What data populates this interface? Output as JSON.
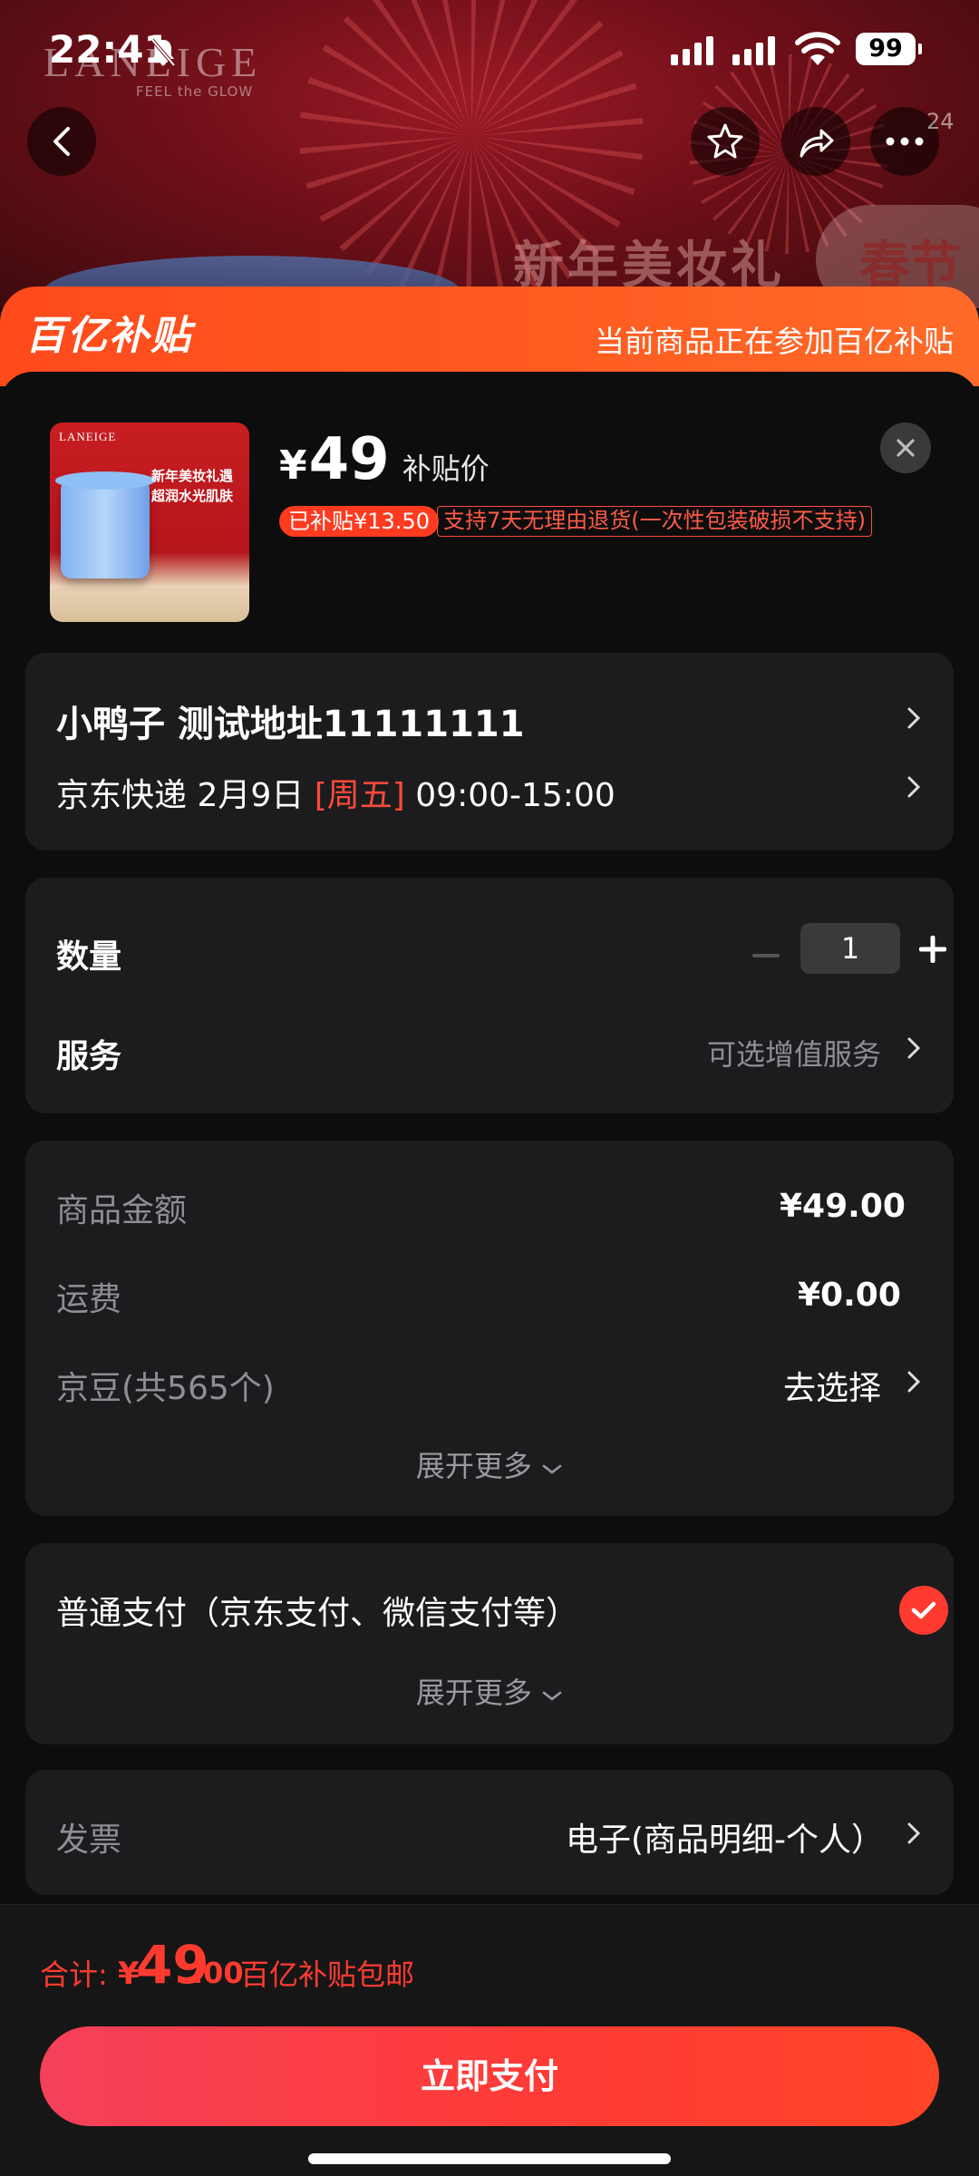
{
  "status_bar": {
    "time": "22:41",
    "battery": "99"
  },
  "hero": {
    "brand": "LANEIGE",
    "tagline": "FEEL the GLOW",
    "title": "新年美妆礼",
    "pill_text": "春节",
    "notification_count": "24"
  },
  "subsidy_header": {
    "logo_text": "百亿补贴",
    "notice": "当前商品正在参加百亿补贴"
  },
  "product": {
    "thumb_brand": "LANEIGE",
    "thumb_line1": "新年美妆礼遇",
    "thumb_line2": "超润水光肌肤",
    "price_symbol": "¥",
    "price": "49",
    "price_label": "补贴价",
    "subsidy_badge": "已补贴¥13.50",
    "return_policy": "支持7天无理由退货(一次性包装破损不支持)"
  },
  "address": {
    "name_line": "小鸭子  测试地址11111111",
    "courier": "京东快递 2月9日",
    "weekday": "[周五]",
    "time_window": "09:00-15:00"
  },
  "options": {
    "quantity_label": "数量",
    "quantity_value": "1",
    "service_label": "服务",
    "service_value": "可选增值服务"
  },
  "cost": {
    "goods_label": "商品金额",
    "goods_value": "¥49.00",
    "shipping_label": "运费",
    "shipping_value": "¥0.00",
    "beans_label": "京豆(共565个)",
    "beans_action": "去选择",
    "expand": "展开更多"
  },
  "payment": {
    "method": "普通支付（京东支付、微信支付等）",
    "expand": "展开更多"
  },
  "invoice": {
    "label": "发票",
    "value": "电子(商品明细-个人）"
  },
  "footer": {
    "total_label": "合计:",
    "currency": "¥",
    "total_int": "49",
    "total_dec": ".00",
    "note": "百亿补贴包邮",
    "pay_button": "立即支付"
  },
  "colors": {
    "accent": "#ff3b30",
    "header_orange": "#ff5a1f",
    "card_bg": "#1c1c1e"
  }
}
